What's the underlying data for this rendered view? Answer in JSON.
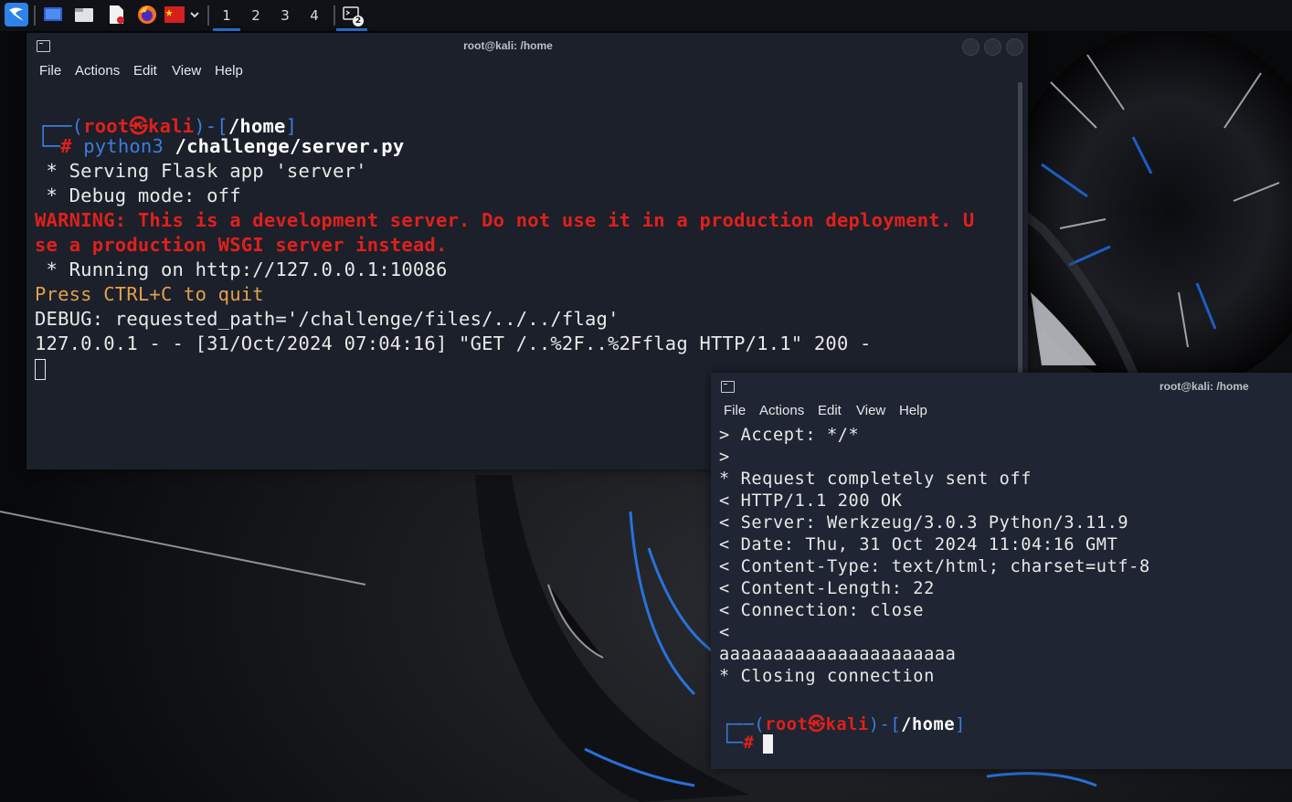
{
  "taskbar": {
    "workspaces": [
      "1",
      "2",
      "3",
      "4"
    ],
    "active_workspace": "1",
    "task_badge": "2",
    "icons": [
      "kali-menu-icon",
      "desktop-icon",
      "file-manager-icon",
      "text-editor-icon",
      "firefox-icon",
      "flag-app-icon",
      "chevron-down-icon",
      "terminal-task-icon"
    ]
  },
  "window1": {
    "title": "root@kali: /home",
    "menu": [
      "File",
      "Actions",
      "Edit",
      "View",
      "Help"
    ],
    "prompt": {
      "open": "┌──(",
      "user": "root",
      "skull": "㉿",
      "host": "kali",
      "mid": ")-[",
      "path": "/home",
      "close": "]",
      "corner": "└─",
      "hash": "#"
    },
    "command": {
      "cmd": "python3",
      "arg": "/challenge/server.py"
    },
    "lines": [
      " * Serving Flask app 'server'",
      " * Debug mode: off"
    ],
    "warning": [
      "WARNING: This is a development server. Do not use it in a production deployment. U",
      "se a production WSGI server instead."
    ],
    "running": " * Running on http://127.0.0.1:10086",
    "quit": "Press CTRL+C to quit",
    "debug": "DEBUG: requested_path='/challenge/files/../../flag'",
    "access": "127.0.0.1 - - [31/Oct/2024 07:04:16] \"GET /..%2F..%2Fflag HTTP/1.1\" 200 -"
  },
  "window2": {
    "title": "root@kali: /home",
    "menu": [
      "File",
      "Actions",
      "Edit",
      "View",
      "Help"
    ],
    "lines": [
      "> Accept: */*",
      ">",
      "* Request completely sent off",
      "< HTTP/1.1 200 OK",
      "< Server: Werkzeug/3.0.3 Python/3.11.9",
      "< Date: Thu, 31 Oct 2024 11:04:16 GMT",
      "< Content-Type: text/html; charset=utf-8",
      "< Content-Length: 22",
      "< Connection: close",
      "<",
      "aaaaaaaaaaaaaaaaaaaaaa",
      "* Closing connection"
    ],
    "prompt": {
      "open": "┌──(",
      "user": "root",
      "skull": "㉿",
      "host": "kali",
      "mid": ")-[",
      "path": "/home",
      "close": "]",
      "corner": "└─",
      "hash": "#"
    }
  },
  "colors": {
    "accent": "#2d7de8",
    "prompt_blue": "#3c7ddc",
    "prompt_red": "#e0201a",
    "warning_red": "#e0201a",
    "quit_orange": "#e3a04a",
    "window_bg": "#1d2330"
  }
}
